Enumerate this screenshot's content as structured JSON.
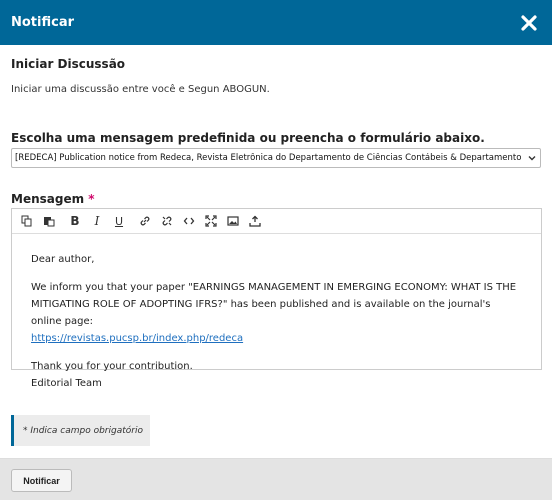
{
  "modal": {
    "title": "Notificar",
    "close_icon": "close-icon"
  },
  "discussion": {
    "title": "Iniciar Discussão",
    "description": "Iniciar uma discussão entre você e Segun ABOGUN."
  },
  "template": {
    "label": "Escolha uma mensagem predefinida ou preencha o formulário abaixo.",
    "selected": "[REDECA] Publication notice from Redeca, Revista Eletrônica do Departamento de Ciências Contábeis & Departamento"
  },
  "message": {
    "label": "Mensagem",
    "required_mark": "*",
    "toolbar_icons": [
      "copy-icon",
      "paste-icon",
      "bold-icon",
      "italic-icon",
      "underline-icon",
      "link-icon",
      "unlink-icon",
      "code-icon",
      "fullscreen-icon",
      "image-icon",
      "upload-icon"
    ],
    "body": {
      "greeting": "Dear author,",
      "paragraph": "We inform you that your paper \"EARNINGS MANAGEMENT IN EMERGING ECONOMY: WHAT IS THE MITIGATING ROLE OF ADOPTING IFRS?\" has been published and is available on the journal's online page:",
      "link": "https://revistas.pucsp.br/index.php/redeca",
      "closing": "Thank you for your contribution.",
      "signature": "Editorial Team"
    }
  },
  "required_note": "* Indica campo obrigatório",
  "footer": {
    "submit_label": "Notificar"
  },
  "colors": {
    "header": "#006798",
    "required": "#d00a6c",
    "link": "#1e6fbf"
  }
}
